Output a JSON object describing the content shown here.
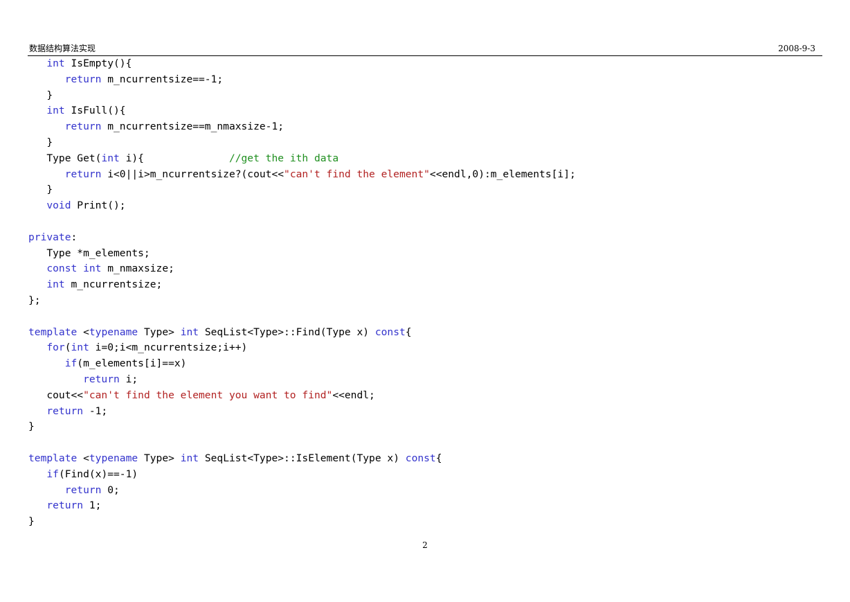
{
  "header": {
    "title": "数据结构算法实现",
    "date": "2008-9-3"
  },
  "page_number": "2",
  "code_lines": [
    [
      [
        "   ",
        ""
      ],
      [
        "int",
        "kw"
      ],
      [
        " IsEmpty(){",
        ""
      ]
    ],
    [
      [
        "      ",
        ""
      ],
      [
        "return",
        "kw"
      ],
      [
        " m_ncurrentsize==-1;",
        ""
      ]
    ],
    [
      [
        "   }",
        ""
      ]
    ],
    [
      [
        "   ",
        ""
      ],
      [
        "int",
        "kw"
      ],
      [
        " IsFull(){",
        ""
      ]
    ],
    [
      [
        "      ",
        ""
      ],
      [
        "return",
        "kw"
      ],
      [
        " m_ncurrentsize==m_nmaxsize-1;",
        ""
      ]
    ],
    [
      [
        "   }",
        ""
      ]
    ],
    [
      [
        "   Type Get(",
        ""
      ],
      [
        "int",
        "kw"
      ],
      [
        " i){              ",
        ""
      ],
      [
        "//get the ith data",
        "cm"
      ]
    ],
    [
      [
        "      ",
        ""
      ],
      [
        "return",
        "kw"
      ],
      [
        " i<0||i>m_ncurrentsize?(cout<<",
        ""
      ],
      [
        "\"can't find the element\"",
        "str"
      ],
      [
        "<<endl,0):m_elements[i];",
        ""
      ]
    ],
    [
      [
        "   }",
        ""
      ]
    ],
    [
      [
        "   ",
        ""
      ],
      [
        "void",
        "kw"
      ],
      [
        " Print();",
        ""
      ]
    ],
    [],
    [
      [
        "private",
        "kw"
      ],
      [
        ":",
        ""
      ]
    ],
    [
      [
        "   Type *m_elements;",
        ""
      ]
    ],
    [
      [
        "   ",
        ""
      ],
      [
        "const",
        "kw"
      ],
      [
        " ",
        ""
      ],
      [
        "int",
        "kw"
      ],
      [
        " m_nmaxsize;",
        ""
      ]
    ],
    [
      [
        "   ",
        ""
      ],
      [
        "int",
        "kw"
      ],
      [
        " m_ncurrentsize;",
        ""
      ]
    ],
    [
      [
        "};",
        ""
      ]
    ],
    [],
    [
      [
        "template",
        "kw"
      ],
      [
        " <",
        ""
      ],
      [
        "typename",
        "kw"
      ],
      [
        " Type> ",
        ""
      ],
      [
        "int",
        "kw"
      ],
      [
        " SeqList<Type>::Find(Type x) ",
        ""
      ],
      [
        "const",
        "kw"
      ],
      [
        "{",
        ""
      ]
    ],
    [
      [
        "   ",
        ""
      ],
      [
        "for",
        "kw"
      ],
      [
        "(",
        ""
      ],
      [
        "int",
        "kw"
      ],
      [
        " i=0;i<m_ncurrentsize;i++)",
        ""
      ]
    ],
    [
      [
        "      ",
        ""
      ],
      [
        "if",
        "kw"
      ],
      [
        "(m_elements[i]==x)",
        ""
      ]
    ],
    [
      [
        "         ",
        ""
      ],
      [
        "return",
        "kw"
      ],
      [
        " i;",
        ""
      ]
    ],
    [
      [
        "   cout<<",
        ""
      ],
      [
        "\"can't find the element you want to find\"",
        "str"
      ],
      [
        "<<endl;",
        ""
      ]
    ],
    [
      [
        "   ",
        ""
      ],
      [
        "return",
        "kw"
      ],
      [
        " -1;",
        ""
      ]
    ],
    [
      [
        "}",
        ""
      ]
    ],
    [],
    [
      [
        "template",
        "kw"
      ],
      [
        " <",
        ""
      ],
      [
        "typename",
        "kw"
      ],
      [
        " Type> ",
        ""
      ],
      [
        "int",
        "kw"
      ],
      [
        " SeqList<Type>::IsElement(Type x) ",
        ""
      ],
      [
        "const",
        "kw"
      ],
      [
        "{",
        ""
      ]
    ],
    [
      [
        "   ",
        ""
      ],
      [
        "if",
        "kw"
      ],
      [
        "(Find(x)==-1)",
        ""
      ]
    ],
    [
      [
        "      ",
        ""
      ],
      [
        "return",
        "kw"
      ],
      [
        " 0;",
        ""
      ]
    ],
    [
      [
        "   ",
        ""
      ],
      [
        "return",
        "kw"
      ],
      [
        " 1;",
        ""
      ]
    ],
    [
      [
        "}",
        ""
      ]
    ]
  ]
}
